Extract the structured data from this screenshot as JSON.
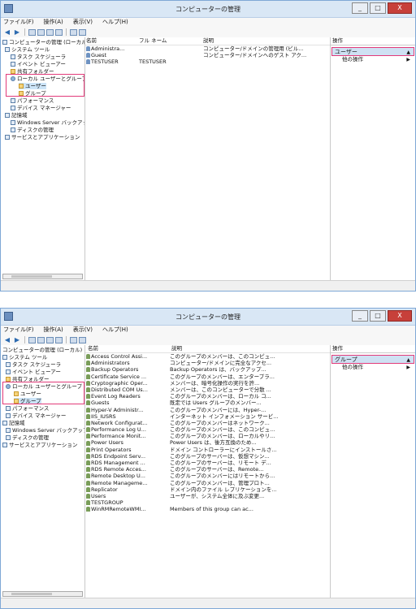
{
  "title": "コンピューターの管理",
  "menu": [
    "ファイル(F)",
    "操作(A)",
    "表示(V)",
    "ヘルプ(H)"
  ],
  "window_controls": {
    "minimize": "_",
    "maximize": "□",
    "close": "X"
  },
  "actions_header": "操作",
  "other_actions": "他の操作",
  "top": {
    "tree": [
      "コンピューターの管理 (ローカル)",
      "システム ツール",
      "タスク スケジューラ",
      "イベント ビューアー",
      "共有フォルダー",
      "ローカル ユーザーとグループ",
      "ユーザー",
      "グループ",
      "パフォーマンス",
      "デバイス マネージャー",
      "記憶域",
      "Windows Server バックアップ",
      "ディスクの管理",
      "サービスとアプリケーション"
    ],
    "columns": [
      "名前",
      "フル ネーム",
      "説明"
    ],
    "rows": [
      {
        "name": "Administra...",
        "full": "",
        "desc": "コンピューター/ドメインの管理用 (ビル..."
      },
      {
        "name": "Guest",
        "full": "",
        "desc": "コンピューター/ドメインへのゲスト アク..."
      },
      {
        "name": "TESTUSER",
        "full": "TESTUSER",
        "desc": ""
      }
    ],
    "action_section": "ユーザー"
  },
  "bottom": {
    "tree": [
      "コンピューターの管理 (ローカル)",
      "システム ツール",
      "タスク スケジューラ",
      "イベント ビューアー",
      "共有フォルダー",
      "ローカル ユーザーとグループ",
      "ユーザー",
      "グループ",
      "パフォーマンス",
      "デバイス マネージャー",
      "記憶域",
      "Windows Server バックアップ",
      "ディスクの管理",
      "サービスとアプリケーション"
    ],
    "columns": [
      "名前",
      "説明"
    ],
    "rows": [
      {
        "name": "Access Control Assi...",
        "desc": "このグループのメンバーは、このコンピュ..."
      },
      {
        "name": "Administrators",
        "desc": "コンピューター/ドメインに完全なアクセ..."
      },
      {
        "name": "Backup Operators",
        "desc": "Backup Operators は、バックアップ..."
      },
      {
        "name": "Certificate Service ...",
        "desc": "このグループのメンバーは、エンタープラ..."
      },
      {
        "name": "Cryptographic Oper...",
        "desc": "メンバーは、暗号化操作の実行を許..."
      },
      {
        "name": "Distributed COM Us...",
        "desc": "メンバーは、このコンピューターで分散 ..."
      },
      {
        "name": "Event Log Readers",
        "desc": "このグループのメンバーは、ローカル コ..."
      },
      {
        "name": "Guests",
        "desc": "既定では Users グループのメンバー..."
      },
      {
        "name": "Hyper-V Administr...",
        "desc": "このグループのメンバーには、Hyper-..."
      },
      {
        "name": "IIS_IUSRS",
        "desc": "インターネット インフォメーション サービ..."
      },
      {
        "name": "Network Configurat...",
        "desc": "このグループのメンバーはネットワーク..."
      },
      {
        "name": "Performance Log U...",
        "desc": "このグループのメンバーは、このコンピュ..."
      },
      {
        "name": "Performance Monit...",
        "desc": "このグループのメンバーは、ローカルやリ..."
      },
      {
        "name": "Power Users",
        "desc": "Power Users は、後方互換のため..."
      },
      {
        "name": "Print Operators",
        "desc": "ドメイン コントローラーにインストールさ..."
      },
      {
        "name": "RDS Endpoint Serv...",
        "desc": "このグループのサーバーは、仮想マシン..."
      },
      {
        "name": "RDS Management ...",
        "desc": "このグループのサーバーは、リモート デ..."
      },
      {
        "name": "RDS Remote Acces...",
        "desc": "このグループのサーバーは、Remote..."
      },
      {
        "name": "Remote Desktop U...",
        "desc": "このグループのメンバーにはリモートから..."
      },
      {
        "name": "Remote Manageme...",
        "desc": "このグループのメンバーは、管理プロト..."
      },
      {
        "name": "Replicator",
        "desc": "ドメイン内のファイル レプリケーションを..."
      },
      {
        "name": "Users",
        "desc": "ユーザーが、システム全体に及ぶ変更..."
      },
      {
        "name": "TESTGROUP",
        "desc": ""
      },
      {
        "name": "WinRMRemoteWMI...",
        "desc": "Members of this group can ac..."
      }
    ],
    "action_section": "グループ"
  }
}
